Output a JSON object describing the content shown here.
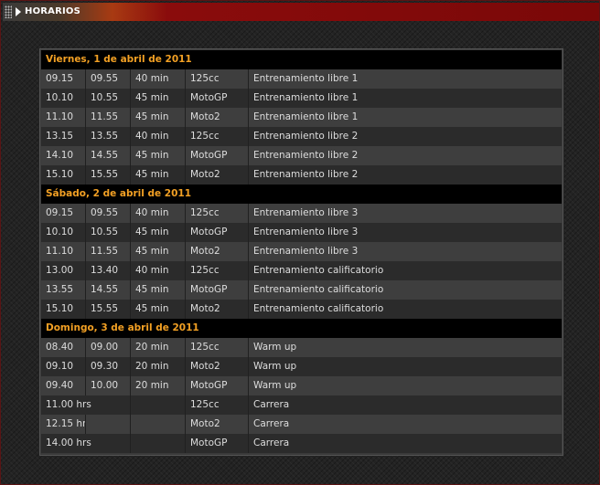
{
  "header": {
    "title": "HORARIOS"
  },
  "schedule": [
    {
      "day": "Viernes, 1 de abril de 2011",
      "rows": [
        {
          "start": "09.15",
          "end": "09.55",
          "dur": "40 min",
          "cat": "125cc",
          "session": "Entrenamiento libre 1"
        },
        {
          "start": "10.10",
          "end": "10.55",
          "dur": "45 min",
          "cat": "MotoGP",
          "session": "Entrenamiento libre 1"
        },
        {
          "start": "11.10",
          "end": "11.55",
          "dur": "45 min",
          "cat": "Moto2",
          "session": "Entrenamiento libre 1"
        },
        {
          "start": "13.15",
          "end": "13.55",
          "dur": "40 min",
          "cat": "125cc",
          "session": "Entrenamiento libre 2"
        },
        {
          "start": "14.10",
          "end": "14.55",
          "dur": "45 min",
          "cat": "MotoGP",
          "session": "Entrenamiento libre 2"
        },
        {
          "start": "15.10",
          "end": "15.55",
          "dur": "45 min",
          "cat": "Moto2",
          "session": "Entrenamiento libre 2"
        }
      ]
    },
    {
      "day": "Sábado, 2 de abril de 2011",
      "rows": [
        {
          "start": "09.15",
          "end": "09.55",
          "dur": "40 min",
          "cat": "125cc",
          "session": "Entrenamiento libre 3"
        },
        {
          "start": "10.10",
          "end": "10.55",
          "dur": "45 min",
          "cat": "MotoGP",
          "session": "Entrenamiento libre 3"
        },
        {
          "start": "11.10",
          "end": "11.55",
          "dur": "45 min",
          "cat": "Moto2",
          "session": "Entrenamiento libre 3"
        },
        {
          "start": "13.00",
          "end": "13.40",
          "dur": "40 min",
          "cat": "125cc",
          "session": "Entrenamiento calificatorio"
        },
        {
          "start": "13.55",
          "end": "14.55",
          "dur": "45 min",
          "cat": "MotoGP",
          "session": "Entrenamiento calificatorio"
        },
        {
          "start": "15.10",
          "end": "15.55",
          "dur": "45 min",
          "cat": "Moto2",
          "session": "Entrenamiento calificatorio"
        }
      ]
    },
    {
      "day": "Domingo, 3 de abril de 2011",
      "rows": [
        {
          "start": "08.40",
          "end": "09.00",
          "dur": "20 min",
          "cat": "125cc",
          "session": "Warm up"
        },
        {
          "start": "09.10",
          "end": "09.30",
          "dur": "20 min",
          "cat": "Moto2",
          "session": "Warm up"
        },
        {
          "start": "09.40",
          "end": "10.00",
          "dur": "20 min",
          "cat": "MotoGP",
          "session": "Warm up"
        },
        {
          "start": "11.00 hrs",
          "merged": true,
          "dur": "",
          "cat": "125cc",
          "session": "Carrera"
        },
        {
          "start": "12.15 hrs",
          "end": "",
          "dur": "",
          "cat": "Moto2",
          "session": "Carrera"
        },
        {
          "start": "14.00 hrs",
          "merged": true,
          "dur": "",
          "cat": "MotoGP",
          "session": "Carrera"
        }
      ]
    }
  ]
}
